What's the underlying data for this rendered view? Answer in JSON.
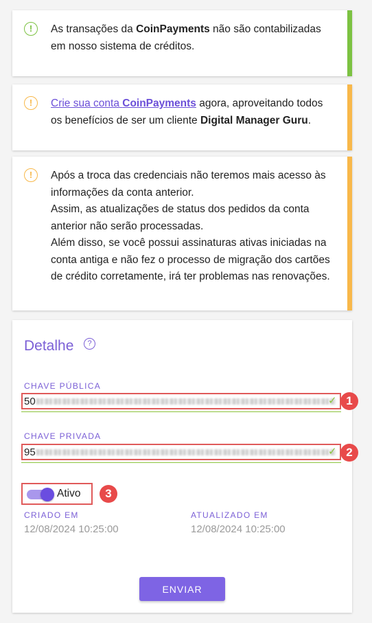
{
  "alerts": [
    {
      "icon": "!",
      "parts": [
        "As transações da ",
        "CoinPayments",
        " não são contabilizadas em nosso sistema de créditos."
      ]
    },
    {
      "icon": "!",
      "link_pre": "Crie sua conta ",
      "link_bold": "CoinPayments",
      "parts": [
        " agora, aproveitando todos os benefícios de ser um cliente ",
        "Digital Manager Guru",
        "."
      ]
    },
    {
      "icon": "!",
      "lines": [
        "Após a troca das credenciais não teremos mais acesso às informações da conta anterior.",
        "Assim, as atualizações de status dos pedidos da conta anterior não serão processadas.",
        "Além disso, se você possui assinaturas ativas iniciadas na conta antiga e não fez o processo de migração dos cartões de crédito corretamente, irá ter problemas nas renovações."
      ]
    }
  ],
  "detail": {
    "title": "Detalhe",
    "help_icon": "?",
    "public_key_label": "CHAVE PÚBLICA",
    "public_key_value": "50",
    "private_key_label": "CHAVE PRIVADA",
    "private_key_value": "95",
    "check_mark": "✓",
    "active_label": "Ativo",
    "active": true,
    "created_label": "CRIADO EM",
    "created_value": "12/08/2024 10:25:00",
    "updated_label": "ATUALIZADO EM",
    "updated_value": "12/08/2024 10:25:00",
    "send_label": "ENVIAR"
  },
  "badges": [
    "1",
    "2",
    "3"
  ],
  "colors": {
    "accent": "#7b5fd6",
    "success": "#7cc242",
    "warning": "#f8b84a",
    "highlight": "#e84a4a"
  }
}
